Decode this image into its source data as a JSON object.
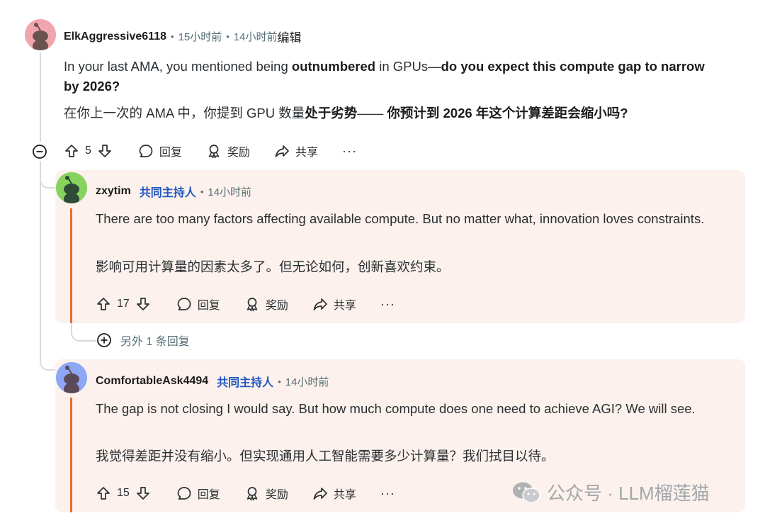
{
  "comments": [
    {
      "author": "ElkAggressive6118",
      "time": "15小时前",
      "edited_time": "14小时前",
      "edited_label": "编辑",
      "en_parts": [
        "In your last AMA, you mentioned being ",
        "outnumbered",
        " in GPUs—",
        "do you expect this compute gap to narrow by 2026?"
      ],
      "zh_parts": [
        "在你上一次的 AMA 中，你提到 GPU 数量",
        "处于劣势",
        "—— ",
        "你预计到 2026 年这个计算差距会缩小吗?"
      ],
      "votes": "5",
      "avatar_color": "#f1a5ad"
    },
    {
      "author": "zxytim",
      "badge": "共同主持人",
      "time": "14小时前",
      "en": "There are too many factors affecting available compute. But no matter what, innovation loves constraints.",
      "zh": "影响可用计算量的因素太多了。但无论如何，创新喜欢约束。",
      "votes": "17",
      "avatar_color": "#86d35d"
    },
    {
      "author": "ComfortableAsk4494",
      "badge": "共同主持人",
      "time": "14小时前",
      "en": "The gap is not closing I would say. But how much compute does one need to achieve AGI? We will see.",
      "zh": "我觉得差距并没有缩小。但实现通用人工智能需要多少计算量？我们拭目以待。",
      "votes": "15",
      "avatar_color": "#8ea7f4"
    }
  ],
  "actions": {
    "reply": "回复",
    "award": "奖励",
    "share": "共享",
    "more": "···"
  },
  "more_replies": "另外 1 条回复",
  "watermark": "公众号 · LLM榴莲猫",
  "colors": {
    "card_bg": "#fcf1ec",
    "accent_orange": "#f26a2e",
    "badge_blue": "#1f57c3",
    "meta_gray": "#576f76"
  }
}
